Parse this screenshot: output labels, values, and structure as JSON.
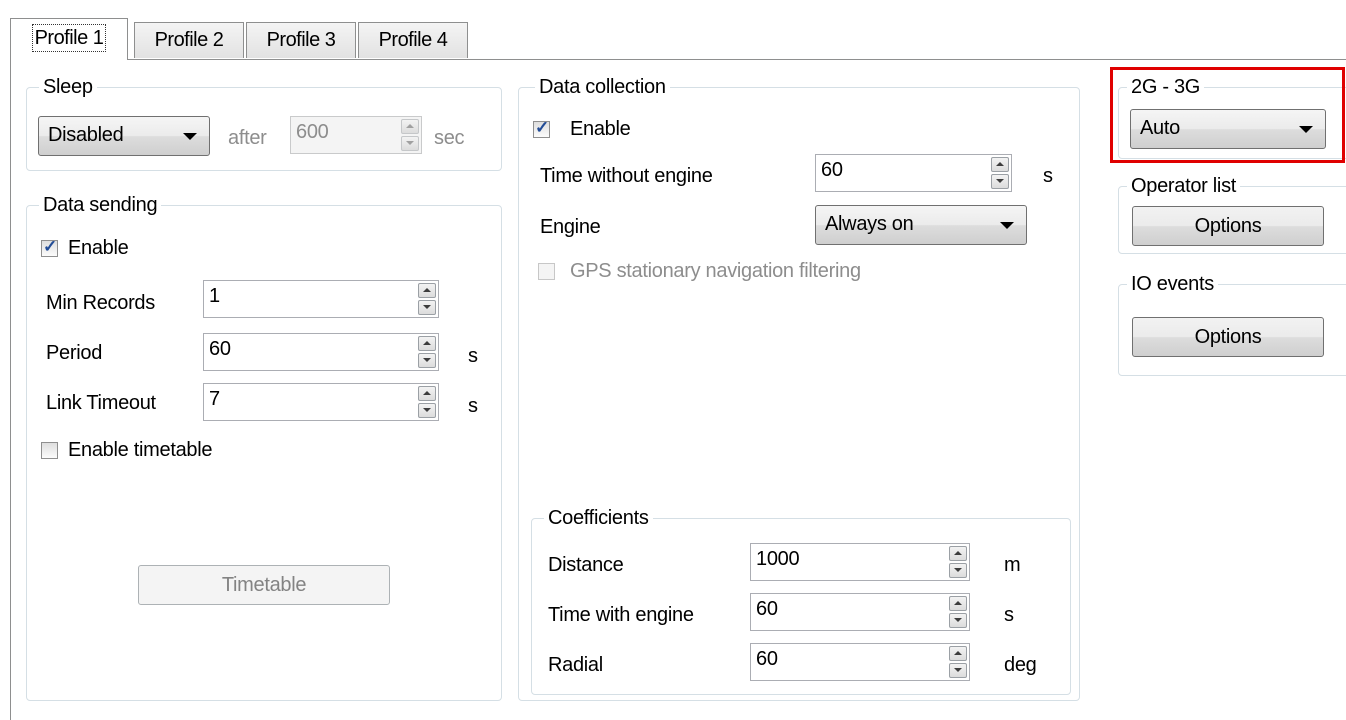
{
  "tabs": [
    {
      "label": "Profile 1",
      "active": true
    },
    {
      "label": "Profile 2",
      "active": false
    },
    {
      "label": "Profile 3",
      "active": false
    },
    {
      "label": "Profile 4",
      "active": false
    }
  ],
  "sleep": {
    "title": "Sleep",
    "mode": "Disabled",
    "after_label": "after",
    "value": "600",
    "unit": "sec"
  },
  "data_sending": {
    "title": "Data sending",
    "enable_label": "Enable",
    "enable_checked": true,
    "min_records": {
      "label": "Min Records",
      "value": "1"
    },
    "period": {
      "label": "Period",
      "value": "60",
      "unit": "s"
    },
    "link_timeout": {
      "label": "Link Timeout",
      "value": "7",
      "unit": "s"
    },
    "timetable_label": "Enable timetable",
    "timetable_checked": false,
    "timetable_button": "Timetable"
  },
  "data_collection": {
    "title": "Data collection",
    "enable_label": "Enable",
    "enable_checked": true,
    "time_without_engine": {
      "label": "Time without engine",
      "value": "60",
      "unit": "s"
    },
    "engine": {
      "label": "Engine",
      "value": "Always on"
    },
    "gps_filter_label": "GPS stationary navigation filtering",
    "gps_filter_checked": false
  },
  "coefficients": {
    "title": "Coefficients",
    "distance": {
      "label": "Distance",
      "value": "1000",
      "unit": "m"
    },
    "time_with_engine": {
      "label": "Time with engine",
      "value": "60",
      "unit": "s"
    },
    "radial": {
      "label": "Radial",
      "value": "60",
      "unit": "deg"
    }
  },
  "network": {
    "title": "2G - 3G",
    "mode": "Auto"
  },
  "operator_list": {
    "title": "Operator list",
    "button": "Options"
  },
  "io_events": {
    "title": "IO events",
    "button": "Options"
  },
  "colors": {
    "highlight": "#e00000",
    "check_mark": "#224c96",
    "disabled_text": "#8d8d8d"
  }
}
